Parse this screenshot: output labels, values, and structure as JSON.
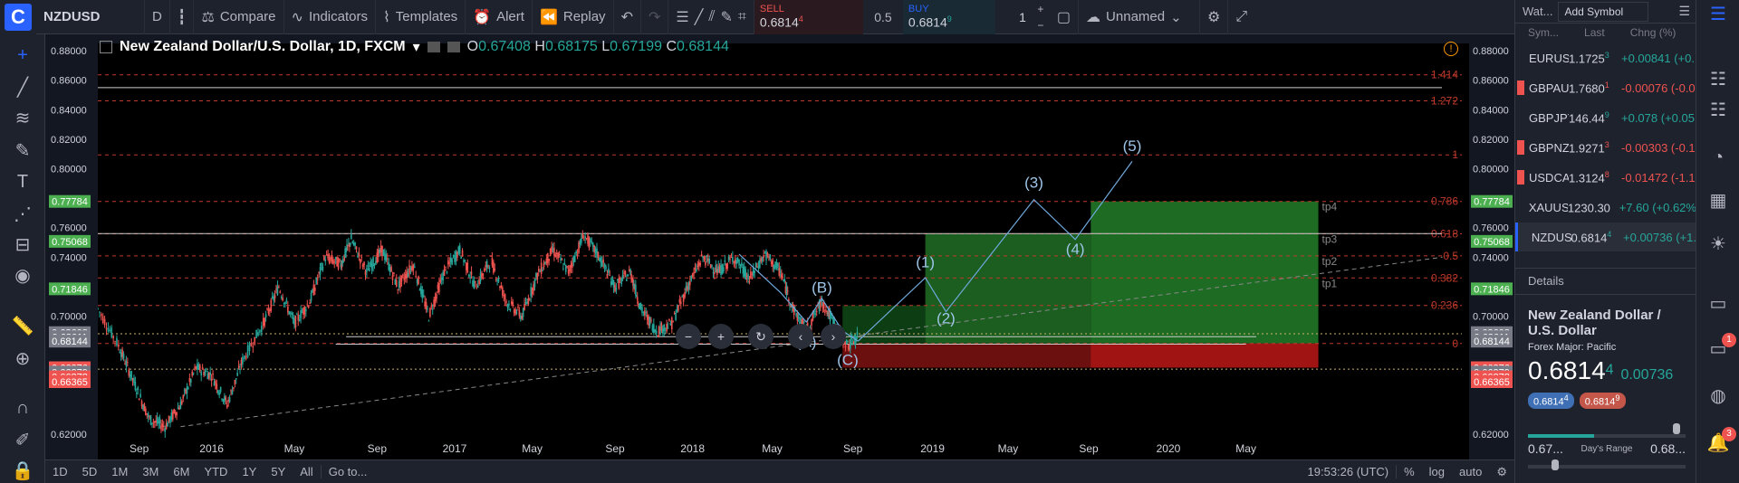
{
  "toolbar": {
    "symbol": "NZDUSD",
    "interval": "D",
    "compare": "Compare",
    "indicators": "Indicators",
    "templates": "Templates",
    "alert": "Alert",
    "replay": "Replay",
    "sell_label": "SELL",
    "sell_price": "0.6814",
    "sell_sup": "4",
    "spread": "0.5",
    "buy_label": "BUY",
    "buy_price": "0.6814",
    "buy_sup": "9",
    "qty": "1",
    "layout_name": "Unnamed"
  },
  "legend": {
    "title": "New Zealand Dollar/U.S. Dollar, 1D, FXCM",
    "o_label": "O",
    "o": "0.67408",
    "h_label": "H",
    "h": "0.68175",
    "l_label": "L",
    "l": "0.67199",
    "c_label": "C",
    "c": "0.68144"
  },
  "price_axis": [
    "0.88000",
    "0.86000",
    "0.84000",
    "0.82000",
    "0.80000",
    "0.76000",
    "0.74000",
    "0.70000",
    "0.62000"
  ],
  "price_tags": [
    {
      "v": "0.77784",
      "color": "#4caf50"
    },
    {
      "v": "0.75068",
      "color": "#4caf50"
    },
    {
      "v": "0.71846",
      "color": "#4caf50"
    },
    {
      "v": "0.68608",
      "color": "#787b86"
    },
    {
      "v": "0.68611",
      "color": "#787b86"
    },
    {
      "v": "0.68144",
      "color": "#787b86"
    },
    {
      "v": "0.66376",
      "color": "#ef5350"
    },
    {
      "v": "0.66379",
      "color": "#787b86"
    },
    {
      "v": "0.66378",
      "color": "#ef5350"
    },
    {
      "v": "0.66365",
      "color": "#ef5350"
    }
  ],
  "fib_labels": [
    "1.414",
    "1.272",
    "1",
    "0.786",
    "0.618",
    "0.5",
    "0.382",
    "0.236",
    "0"
  ],
  "tp_labels": [
    "tp4",
    "tp3",
    "tp2",
    "tp1"
  ],
  "wave_labels": [
    "(5)",
    "(3)",
    "(4)",
    "(1)",
    "(2)",
    "(B)",
    "(A)",
    "(C)"
  ],
  "time_axis": [
    "Sep",
    "2016",
    "May",
    "Sep",
    "2017",
    "May",
    "Sep",
    "2018",
    "May",
    "Sep",
    "2019",
    "May",
    "Sep",
    "2020",
    "May"
  ],
  "bottom": {
    "ranges": [
      "1D",
      "5D",
      "1M",
      "3M",
      "6M",
      "YTD",
      "1Y",
      "5Y",
      "All"
    ],
    "goto": "Go to...",
    "clock": "19:53:26 (UTC)",
    "pct": "%",
    "log": "log",
    "auto": "auto"
  },
  "watchlist": {
    "title": "Wat...",
    "add": "Add Symbol",
    "col_sym": "Sym...",
    "col_last": "Last",
    "col_chg": "Chng (%)",
    "rows": [
      {
        "sym": "EURUSD",
        "last": "1.1725",
        "sup": "3",
        "chg": "+0.00841 (+0.",
        "up": true,
        "flag": false
      },
      {
        "sym": "GBPAUD",
        "last": "1.7680",
        "sup": "1",
        "chg": "-0.00076 (-0.0",
        "up": false,
        "flag": true
      },
      {
        "sym": "GBPJPY",
        "last": "146.44",
        "sup": "9",
        "chg": "+0.078 (+0.05",
        "up": true,
        "flag": false
      },
      {
        "sym": "GBPNZD",
        "last": "1.9271",
        "sup": "3",
        "chg": "-0.00303 (-0.1",
        "up": false,
        "flag": true
      },
      {
        "sym": "USDCAD",
        "last": "1.3124",
        "sup": "8",
        "chg": "-0.01472 (-1.1",
        "up": false,
        "flag": true
      },
      {
        "sym": "XAUUSD",
        "last": "1230.30",
        "sup": "",
        "chg": "+7.60 (+0.62%",
        "up": true,
        "flag": false
      },
      {
        "sym": "NZDUSD",
        "last": "0.6814",
        "sup": "4",
        "chg": "+0.00736 (+1.",
        "up": true,
        "flag": false
      }
    ]
  },
  "details": {
    "header": "Details",
    "name": "New Zealand Dollar / U.S. Dollar",
    "category": "Forex Major: Pacific",
    "price": "0.6814",
    "price_sup": "4",
    "change": "0.00736",
    "bid": "0.6814",
    "bid_sup": "4",
    "ask": "0.6814",
    "ask_sup": "9",
    "range_low": "0.67...",
    "range_label": "Day's Range",
    "range_high": "0.68..."
  },
  "notifications": {
    "badge1": "1",
    "badge2": "3"
  },
  "chart_data": {
    "type": "candlestick",
    "title": "New Zealand Dollar/U.S. Dollar, 1D, FXCM",
    "ylim": [
      0.615,
      0.885
    ],
    "x": [
      "Sep",
      "2016",
      "May",
      "Sep",
      "2017",
      "May",
      "Sep",
      "2018",
      "May",
      "Sep",
      "2019",
      "May",
      "Sep",
      "2020",
      "May"
    ],
    "fib_levels": [
      {
        "label": "1.414",
        "y": 0.8637
      },
      {
        "label": "1.272",
        "y": 0.846
      },
      {
        "label": "1",
        "y": 0.8094
      },
      {
        "label": "0.786",
        "y": 0.7778
      },
      {
        "label": "0.618",
        "y": 0.7558
      },
      {
        "label": "0.5",
        "y": 0.7409
      },
      {
        "label": "0.382",
        "y": 0.7259
      },
      {
        "label": "0.236",
        "y": 0.7072
      },
      {
        "label": "0",
        "y": 0.6814
      }
    ],
    "close_path": [
      [
        0,
        0.705
      ],
      [
        0.02,
        0.68
      ],
      [
        0.035,
        0.655
      ],
      [
        0.05,
        0.63
      ],
      [
        0.065,
        0.625
      ],
      [
        0.08,
        0.64
      ],
      [
        0.095,
        0.665
      ],
      [
        0.11,
        0.66
      ],
      [
        0.125,
        0.64
      ],
      [
        0.14,
        0.67
      ],
      [
        0.16,
        0.695
      ],
      [
        0.175,
        0.72
      ],
      [
        0.19,
        0.695
      ],
      [
        0.205,
        0.71
      ],
      [
        0.22,
        0.74
      ],
      [
        0.235,
        0.735
      ],
      [
        0.245,
        0.752
      ],
      [
        0.26,
        0.73
      ],
      [
        0.275,
        0.745
      ],
      [
        0.29,
        0.72
      ],
      [
        0.305,
        0.735
      ],
      [
        0.32,
        0.7
      ],
      [
        0.335,
        0.73
      ],
      [
        0.35,
        0.745
      ],
      [
        0.365,
        0.72
      ],
      [
        0.38,
        0.738
      ],
      [
        0.395,
        0.71
      ],
      [
        0.41,
        0.7
      ],
      [
        0.425,
        0.728
      ],
      [
        0.44,
        0.745
      ],
      [
        0.455,
        0.73
      ],
      [
        0.47,
        0.755
      ],
      [
        0.485,
        0.74
      ],
      [
        0.5,
        0.72
      ],
      [
        0.515,
        0.73
      ],
      [
        0.525,
        0.705
      ],
      [
        0.54,
        0.69
      ],
      [
        0.555,
        0.695
      ],
      [
        0.57,
        0.72
      ],
      [
        0.585,
        0.74
      ],
      [
        0.6,
        0.73
      ],
      [
        0.615,
        0.74
      ],
      [
        0.63,
        0.725
      ],
      [
        0.645,
        0.742
      ],
      [
        0.66,
        0.73
      ],
      [
        0.672,
        0.705
      ],
      [
        0.685,
        0.69
      ],
      [
        0.7,
        0.71
      ],
      [
        0.712,
        0.695
      ],
      [
        0.725,
        0.68
      ],
      [
        0.735,
        0.686
      ]
    ],
    "waves": [
      [
        0.735,
        0.683
      ],
      [
        0.8,
        0.726
      ],
      [
        0.82,
        0.703
      ],
      [
        0.905,
        0.779
      ],
      [
        0.945,
        0.752
      ],
      [
        1.0,
        0.805
      ]
    ]
  }
}
